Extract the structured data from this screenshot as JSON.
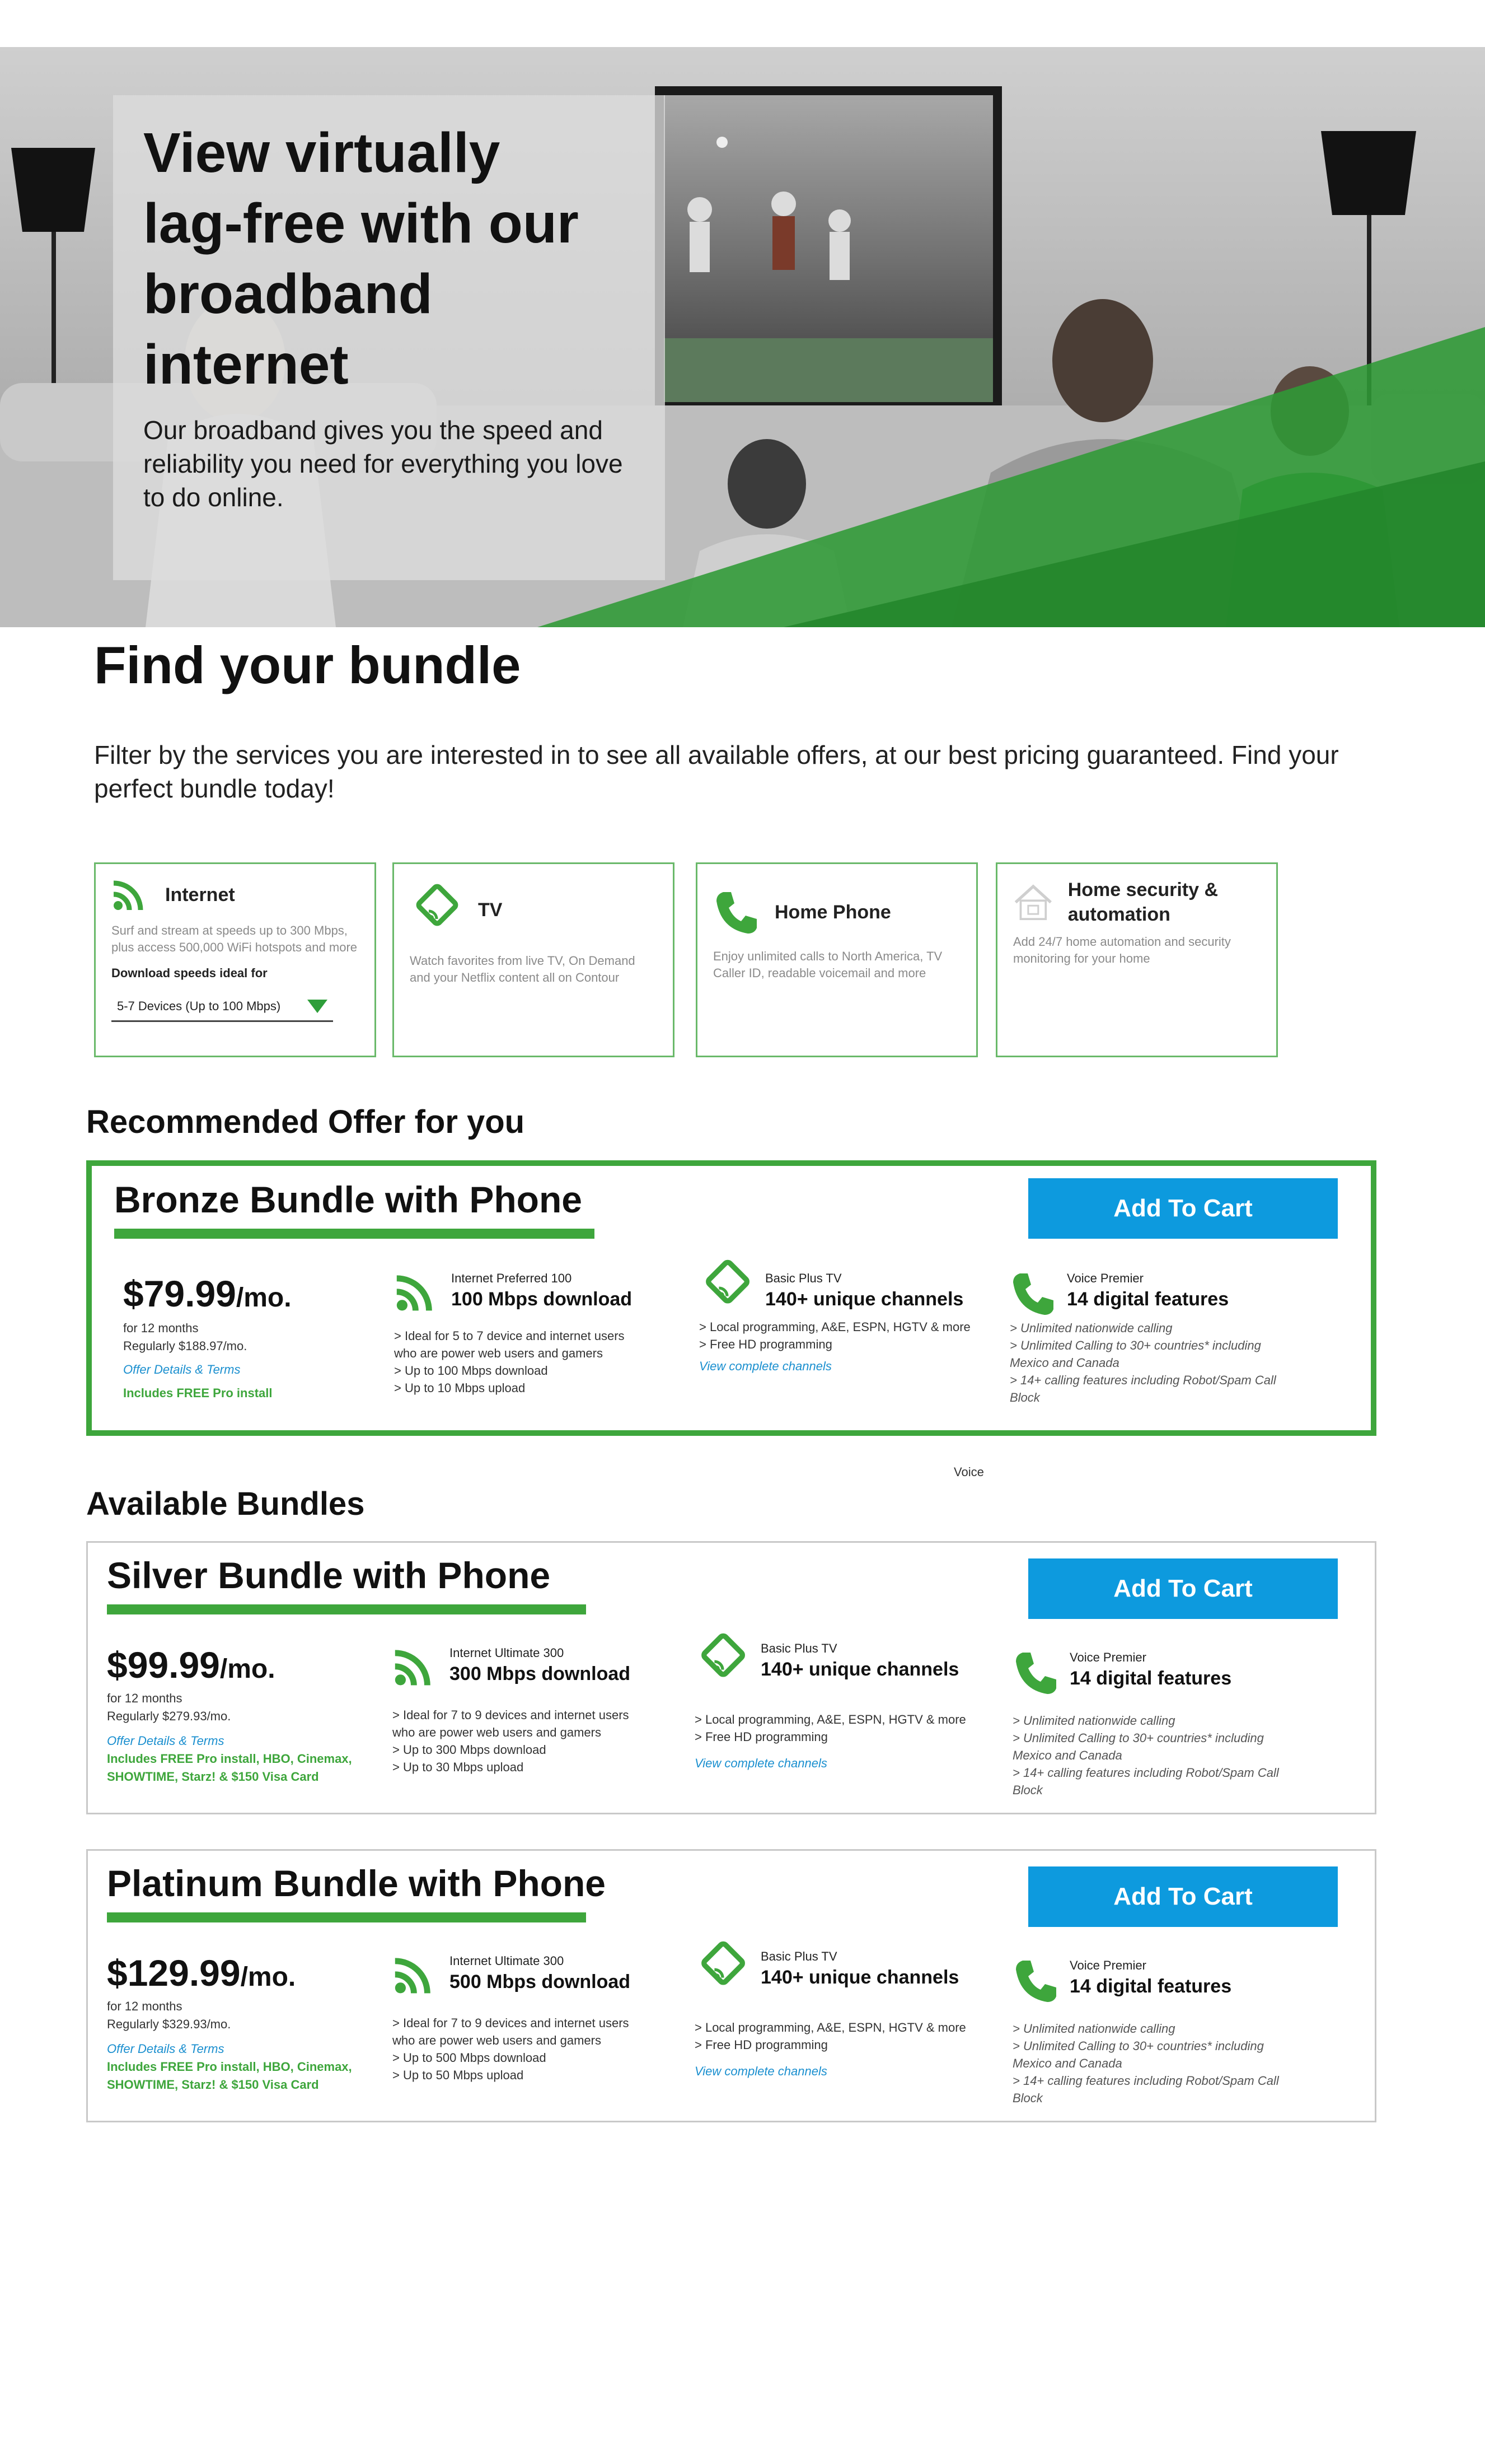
{
  "hero": {
    "title_lines": [
      "View virtually",
      "lag-free with our",
      "broadband",
      "internet"
    ],
    "subtitle": "Our broadband gives you the speed and reliability you need for everything you love to do online."
  },
  "find": {
    "title": "Find your bundle",
    "description": "Filter by the  services you are interested in to see all available offers, at our best pricing guaranteed. Find your perfect bundle today!"
  },
  "filters": [
    {
      "title": "Internet",
      "icon": "wifi-icon",
      "description": "Surf and stream at speeds up to 300 Mbps, plus access 500,000 WiFi hotspots and more",
      "label": "Download speeds ideal for",
      "select_value": "5-7 Devices (Up to 100 Mbps)"
    },
    {
      "title": "TV",
      "icon": "tv-wifi-icon",
      "description": "Watch favorites from live TV, On Demand and your Netflix content all on Contour"
    },
    {
      "title": "Home Phone",
      "icon": "phone-icon",
      "description": "Enjoy unlimited calls to North America, TV Caller ID, readable voicemail and more"
    },
    {
      "title": "Home security & automation",
      "icon": "home-icon",
      "description": "Add 24/7 home automation and security monitoring for your home"
    }
  ],
  "sections": {
    "recommended": "Recommended Offer for you",
    "available": "Available Bundles",
    "stray_label": "Voice"
  },
  "bundles": [
    {
      "title": "Bronze Bundle with Phone",
      "button": "Add To Cart",
      "price": "$79.99",
      "per": "/mo.",
      "term": "for 12 months",
      "regular": "Regularly $188.97/mo.",
      "offer_link": "Offer Details & Terms",
      "promo_lines": [
        "Includes FREE Pro install"
      ],
      "internet": {
        "name": "Internet Preferred 100",
        "headline": "100 Mbps download",
        "bullets": [
          "> Ideal for 5 to 7 device and internet users",
          "who are power web users and gamers",
          "> Up to 100 Mbps download",
          "> Up to 10 Mbps upload"
        ]
      },
      "tv": {
        "name": "Basic Plus TV",
        "headline": "140+ unique channels",
        "bullets": [
          "> Local programming, A&E, ESPN, HGTV & more",
          "> Free HD programming"
        ],
        "link": "View complete channels"
      },
      "voice": {
        "name": "Voice Premier",
        "headline": "14 digital features",
        "bullets": [
          "> Unlimited nationwide calling",
          "> Unlimited Calling to 30+ countries* including",
          "Mexico and Canada",
          "> 14+ calling features including Robot/Spam Call",
          "Block"
        ]
      }
    },
    {
      "title": "Silver Bundle with Phone",
      "button": "Add To Cart",
      "price": "$99.99",
      "per": "/mo.",
      "term": "for 12 months",
      "regular": "Regularly $279.93/mo.",
      "offer_link": "Offer Details & Terms",
      "promo_lines": [
        "Includes FREE Pro install, HBO, Cinemax,",
        "SHOWTIME, Starz! & $150 Visa Card"
      ],
      "internet": {
        "name": "Internet Ultimate 300",
        "headline": "300 Mbps download",
        "bullets": [
          "> Ideal for 7 to 9 devices and internet users",
          "who are power web users and gamers",
          "> Up to 300 Mbps download",
          "> Up to 30 Mbps upload"
        ]
      },
      "tv": {
        "name": "Basic Plus TV",
        "headline": "140+ unique channels",
        "bullets": [
          "> Local programming, A&E, ESPN, HGTV & more",
          "> Free HD programming"
        ],
        "link": "View complete channels"
      },
      "voice": {
        "name": "Voice Premier",
        "headline": "14 digital features",
        "bullets": [
          "> Unlimited nationwide calling",
          "> Unlimited Calling to 30+ countries* including",
          "Mexico and Canada",
          "> 14+ calling features including Robot/Spam Call",
          "Block"
        ]
      }
    },
    {
      "title": "Platinum Bundle with Phone",
      "button": "Add To Cart",
      "price": "$129.99",
      "per": "/mo.",
      "term": "for 12 months",
      "regular": "Regularly $329.93/mo.",
      "offer_link": "Offer Details & Terms",
      "promo_lines": [
        "Includes FREE Pro install, HBO, Cinemax,",
        "SHOWTIME, Starz! & $150 Visa Card"
      ],
      "internet": {
        "name": "Internet Ultimate 300",
        "headline": "500 Mbps download",
        "bullets": [
          "> Ideal for 7 to 9 devices and internet users",
          "who are power web users and gamers",
          "> Up to 500 Mbps download",
          "> Up to 50 Mbps upload"
        ]
      },
      "tv": {
        "name": "Basic Plus TV",
        "headline": "140+ unique channels",
        "bullets": [
          "> Local programming, A&E, ESPN, HGTV & more",
          "> Free HD programming"
        ],
        "link": "View complete channels"
      },
      "voice": {
        "name": "Voice Premier",
        "headline": "14 digital features",
        "bullets": [
          "> Unlimited nationwide calling",
          "> Unlimited Calling to 30+ countries* including",
          "Mexico and Canada",
          "> 14+ calling features including Robot/Spam Call",
          "Block"
        ]
      }
    }
  ],
  "colors": {
    "accent_green": "#3ea63c",
    "button_blue": "#0d9ade",
    "link_blue": "#1a8fcf",
    "filter_border": "#6ab96a"
  }
}
